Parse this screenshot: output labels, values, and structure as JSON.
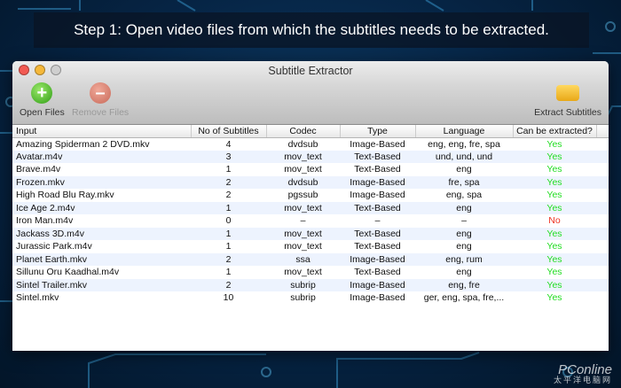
{
  "caption": "Step 1: Open video files from which the subtitles needs to be extracted.",
  "window": {
    "title": "Subtitle Extractor"
  },
  "toolbar": {
    "open_files": "Open Files",
    "remove_files": "Remove Files",
    "extract_subtitles": "Extract Subtitles"
  },
  "table": {
    "headers": [
      "Input",
      "No of Subtitles",
      "Codec",
      "Type",
      "Language",
      "Can be extracted?"
    ],
    "rows": [
      [
        "Amazing Spiderman 2 DVD.mkv",
        "4",
        "dvdsub",
        "Image-Based",
        "eng, eng, fre, spa",
        "Yes"
      ],
      [
        "Avatar.m4v",
        "3",
        "mov_text",
        "Text-Based",
        "und, und, und",
        "Yes"
      ],
      [
        "Brave.m4v",
        "1",
        "mov_text",
        "Text-Based",
        "eng",
        "Yes"
      ],
      [
        "Frozen.mkv",
        "2",
        "dvdsub",
        "Image-Based",
        "fre, spa",
        "Yes"
      ],
      [
        "High Road Blu Ray.mkv",
        "2",
        "pgssub",
        "Image-Based",
        "eng, spa",
        "Yes"
      ],
      [
        "Ice Age 2.m4v",
        "1",
        "mov_text",
        "Text-Based",
        "eng",
        "Yes"
      ],
      [
        "Iron Man.m4v",
        "0",
        "–",
        "–",
        "–",
        "No"
      ],
      [
        "Jackass 3D.m4v",
        "1",
        "mov_text",
        "Text-Based",
        "eng",
        "Yes"
      ],
      [
        "Jurassic Park.m4v",
        "1",
        "mov_text",
        "Text-Based",
        "eng",
        "Yes"
      ],
      [
        "Planet Earth.mkv",
        "2",
        "ssa",
        "Image-Based",
        "eng, rum",
        "Yes"
      ],
      [
        "Sillunu Oru Kaadhal.m4v",
        "1",
        "mov_text",
        "Text-Based",
        "eng",
        "Yes"
      ],
      [
        "Sintel Trailer.mkv",
        "2",
        "subrip",
        "Image-Based",
        "eng, fre",
        "Yes"
      ],
      [
        "Sintel.mkv",
        "10",
        "subrip",
        "Image-Based",
        "ger, eng, spa, fre,...",
        "Yes"
      ]
    ]
  },
  "watermark": {
    "brand": "PConline",
    "sub": "太平洋电脑网"
  },
  "colors": {
    "yes": "#22dd22",
    "no": "#ee3322",
    "alt_row": "#edf3fe"
  }
}
